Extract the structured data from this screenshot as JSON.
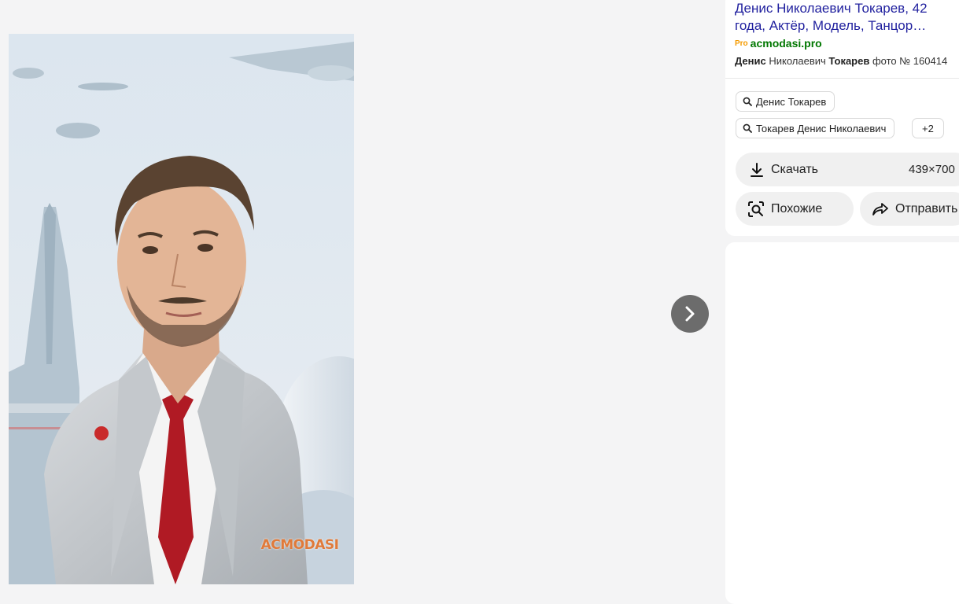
{
  "viewer": {
    "image_alt": "Денис Николаевич Токарев фото",
    "watermark": "ACMODASI",
    "next_icon": "chevron-right-icon"
  },
  "info": {
    "title_line1": "Денис Николаевич Токарев, 42",
    "title_line2": "года, Актёр, Модель, Танцор…",
    "source_badge": "Pro",
    "source_domain": "acmodasi.pro",
    "desc_bold1": "Денис",
    "desc_mid": " Николаевич ",
    "desc_bold2": "Токарев",
    "desc_rest": " фото № 160414"
  },
  "tags": [
    {
      "label": "Денис Токарев",
      "icon": "search-icon"
    },
    {
      "label": "Токарев Денис Николаевич",
      "icon": "search-icon"
    }
  ],
  "tags_more": "+2",
  "actions": {
    "download_label": "Скачать",
    "download_icon": "download-icon",
    "size": "439×700",
    "similar_label": "Похожие",
    "similar_icon": "lens-search-icon",
    "share_label": "Отправить",
    "share_icon": "share-icon"
  }
}
